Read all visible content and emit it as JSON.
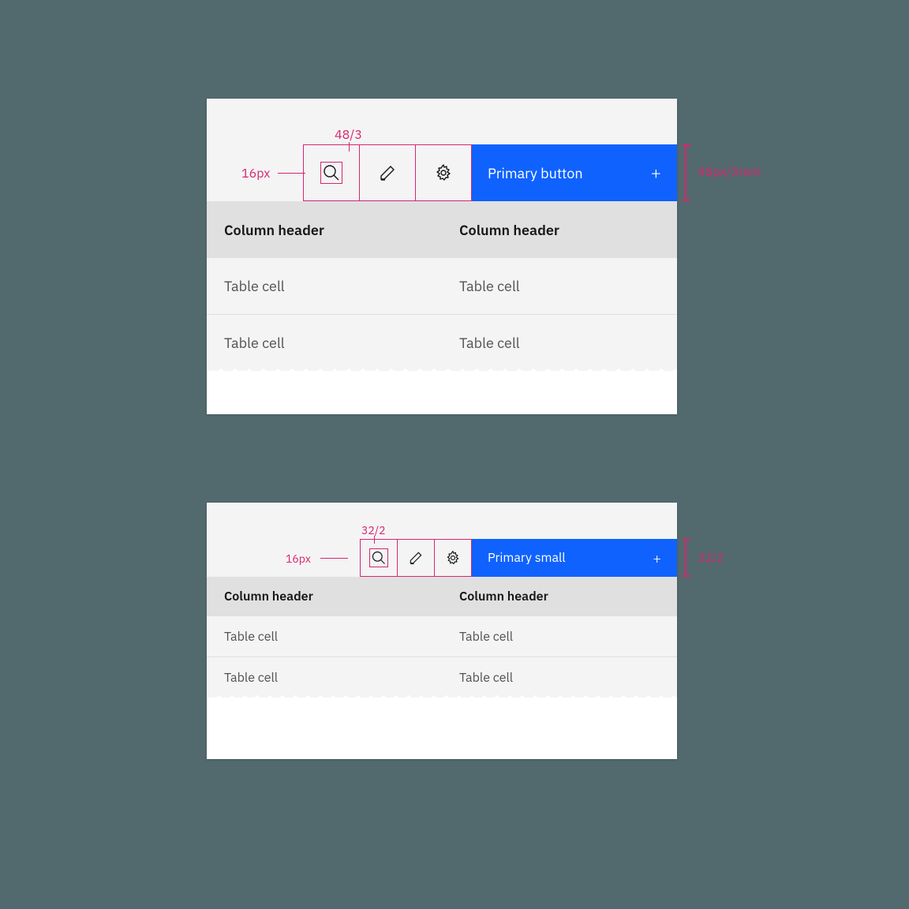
{
  "colors": {
    "primary": "#0f62fe",
    "spec": "#d62670"
  },
  "large": {
    "spec": {
      "button_size": "48/3",
      "icon_size": "16px",
      "height": "48px/3rem"
    },
    "toolbar": {
      "primary_label": "Primary button"
    },
    "headers": [
      "Column header",
      "Column header"
    ],
    "rows": [
      [
        "Table cell",
        "Table cell"
      ],
      [
        "Table cell",
        "Table cell"
      ]
    ]
  },
  "small": {
    "spec": {
      "button_size": "32/2",
      "icon_size": "16px",
      "height": "32/2"
    },
    "toolbar": {
      "primary_label": "Primary small"
    },
    "headers": [
      "Column header",
      "Column header"
    ],
    "rows": [
      [
        "Table cell",
        "Table cell"
      ],
      [
        "Table cell",
        "Table cell"
      ]
    ]
  }
}
